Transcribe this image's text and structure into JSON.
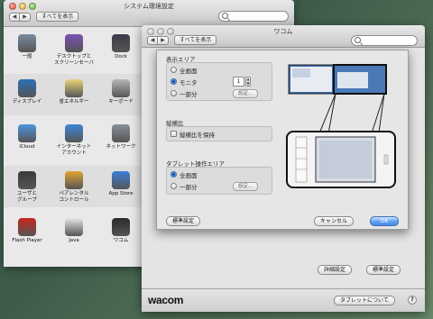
{
  "syspref": {
    "title": "システム環境設定",
    "show_all": "すべてを表示",
    "search_placeholder": "",
    "rows": [
      {
        "items": [
          {
            "label": "一般",
            "icon": "general-icon",
            "color": "#7c8aa0"
          },
          {
            "label": "デスクトップと\nスクリーンセーバ",
            "icon": "desktop-icon",
            "color": "#7a4fb3"
          },
          {
            "label": "Dock",
            "icon": "dock-icon",
            "color": "#3b3b4a"
          },
          {
            "label": "Mission\nControl",
            "icon": "mission-control-icon",
            "color": "#8a4040"
          }
        ]
      },
      {
        "items": [
          {
            "label": "ディスプレイ",
            "icon": "display-icon",
            "color": "#2a6fb8"
          },
          {
            "label": "省エネルギー",
            "icon": "energy-saver-icon",
            "color": "#e9d27a"
          },
          {
            "label": "キーボード",
            "icon": "keyboard-icon",
            "color": "#b6b6b6"
          },
          {
            "label": "マウス",
            "icon": "mouse-icon",
            "color": "#d8d8d8"
          }
        ]
      },
      {
        "items": [
          {
            "label": "iCloud",
            "icon": "icloud-icon",
            "color": "#4d93dd"
          },
          {
            "label": "インターネット\nアカウント",
            "icon": "internet-accounts-icon",
            "color": "#3d86d8"
          },
          {
            "label": "ネットワーク",
            "icon": "network-icon",
            "color": "#8a8f99"
          },
          {
            "label": "Bluetooth",
            "icon": "bluetooth-icon",
            "color": "#2f6fc6"
          }
        ]
      },
      {
        "items": [
          {
            "label": "ユーザと\nグループ",
            "icon": "users-groups-icon",
            "color": "#3a3a3a"
          },
          {
            "label": "ペアレンタル\nコントロール",
            "icon": "parental-controls-icon",
            "color": "#e2a232"
          },
          {
            "label": "App Store",
            "icon": "app-store-icon",
            "color": "#3a7fd8"
          },
          {
            "label": "音声入力\n読み上げ",
            "icon": "dictation-speech-icon",
            "color": "#9a9a9a"
          }
        ]
      },
      {
        "items": [
          {
            "label": "Flash Player",
            "icon": "flash-player-icon",
            "color": "#c8261e"
          },
          {
            "label": "Java",
            "icon": "java-icon",
            "color": "#e6e6e6"
          },
          {
            "label": "ワコム",
            "icon": "wacom-icon",
            "color": "#2a2a2a"
          }
        ]
      }
    ]
  },
  "wacom": {
    "title": "ワコム",
    "show_all": "すべてを表示",
    "logo": "wacom",
    "advanced_button": "詳細設定",
    "default_button": "標準設定",
    "about_tablet_button": "タブレットについて",
    "help_label": "?"
  },
  "sheet": {
    "display_area": {
      "label": "表示エリア",
      "options": [
        "全画面",
        "モニタ",
        "一部分"
      ],
      "selected": 1,
      "monitor_number": "1",
      "settings_button": "設定..."
    },
    "aspect": {
      "label": "縦横比",
      "checkbox_label": "縦横比を保持",
      "checked": false
    },
    "tablet_area": {
      "label": "タブレット操作エリア",
      "options": [
        "全画面",
        "一部分"
      ],
      "selected": 0,
      "settings_button": "設定..."
    },
    "default_button": "標準設定",
    "cancel_button": "キャンセル",
    "ok_button": "OK"
  }
}
